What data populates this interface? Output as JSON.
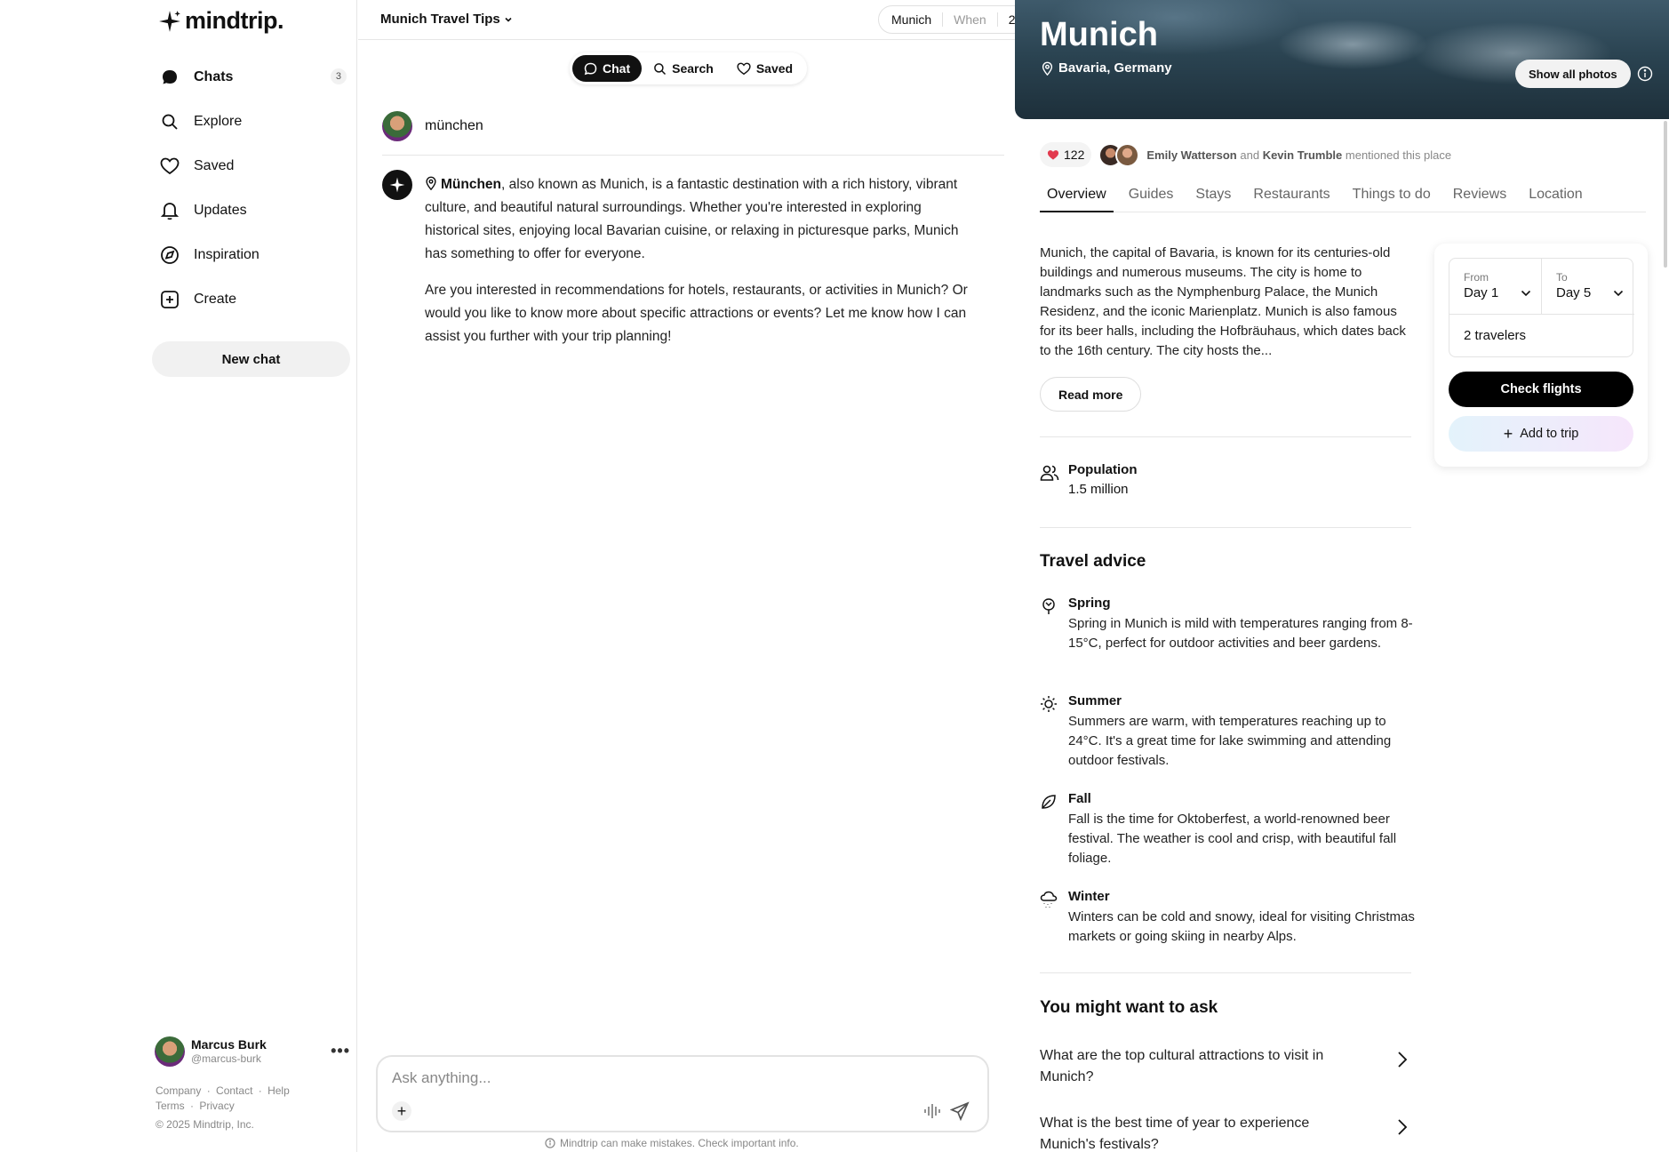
{
  "app": {
    "name": "mindtrip."
  },
  "sidebar": {
    "items": [
      {
        "label": "Chats",
        "icon": "chat-bubble-icon",
        "count": "3"
      },
      {
        "label": "Explore",
        "icon": "search-icon"
      },
      {
        "label": "Saved",
        "icon": "heart-icon"
      },
      {
        "label": "Updates",
        "icon": "bell-icon"
      },
      {
        "label": "Inspiration",
        "icon": "compass-icon"
      },
      {
        "label": "Create",
        "icon": "plus-square-icon"
      }
    ],
    "new_chat": "New chat",
    "user": {
      "name": "Marcus Burk",
      "handle": "@marcus-burk"
    },
    "footer": {
      "links_row1": [
        "Company",
        "·",
        "Contact",
        "·",
        "Help"
      ],
      "links_row2": [
        "Terms",
        "·",
        "Privacy"
      ],
      "copyright": "© 2025 Mindtrip, Inc."
    }
  },
  "header": {
    "trip_title": "Munich Travel Tips",
    "chips": [
      "Munich",
      "When",
      "2"
    ]
  },
  "modes": {
    "chat": "Chat",
    "search": "Search",
    "saved": "Saved"
  },
  "conversation": {
    "user_message": "münchen",
    "ai_bold": "München",
    "ai_p1_rest": ", also known as Munich, is a fantastic destination with a rich history, vibrant culture, and beautiful natural surroundings. Whether you're interested in exploring historical sites, enjoying local Bavarian cuisine, or relaxing in picturesque parks, Munich has something to offer for everyone.",
    "ai_p2": "Are you interested in recommendations for hotels, restaurants, or activities in Munich? Or would you like to know more about specific attractions or events? Let me know how I can assist you further with your trip planning!"
  },
  "composer": {
    "placeholder": "Ask anything...",
    "disclaimer": "Mindtrip can make mistakes. Check important info."
  },
  "place": {
    "name": "Munich",
    "location": "Bavaria, Germany",
    "show_photos": "Show all photos",
    "likes": "122",
    "mention_user1": "Emily Watterson",
    "mention_and": "and",
    "mention_user2": "Kevin Trumble",
    "mention_suffix": "mentioned this place",
    "tabs": [
      "Overview",
      "Guides",
      "Stays",
      "Restaurants",
      "Things to do",
      "Reviews",
      "Location"
    ],
    "overview": "Munich, the capital of Bavaria, is known for its centuries-old buildings and numerous museums. The city is home to landmarks such as the Nymphenburg Palace, the Munich Residenz, and the iconic Marienplatz. Munich is also famous for its beer halls, including the Hofbräuhaus, which dates back to the 16th century. The city hosts the...",
    "read_more": "Read more",
    "population_label": "Population",
    "population_value": "1.5 million",
    "travel_advice_title": "Travel advice",
    "seasons": [
      {
        "name": "Spring",
        "text": "Spring in Munich is mild with temperatures ranging from 8-15°C, perfect for outdoor activities and beer gardens."
      },
      {
        "name": "Summer",
        "text": "Summers are warm, with temperatures reaching up to 24°C. It's a great time for lake swimming and attending outdoor festivals."
      },
      {
        "name": "Fall",
        "text": "Fall is the time for Oktoberfest, a world-renowned beer festival. The weather is cool and crisp, with beautiful fall foliage."
      },
      {
        "name": "Winter",
        "text": "Winters can be cold and snowy, ideal for visiting Christmas markets or going skiing in nearby Alps."
      }
    ],
    "ask_title": "You might want to ask",
    "questions": [
      "What are the top cultural attractions to visit in Munich?",
      "What is the best time of year to experience Munich's festivals?"
    ]
  },
  "booking": {
    "from_label": "From",
    "from_value": "Day 1",
    "to_label": "To",
    "to_value": "Day 5",
    "travelers": "2 travelers",
    "check_flights": "Check flights",
    "add_to_trip": "Add to trip"
  },
  "colors": {
    "accent": "#111111",
    "like": "#e23a4e",
    "hero_dark": "#1d2f3a"
  }
}
